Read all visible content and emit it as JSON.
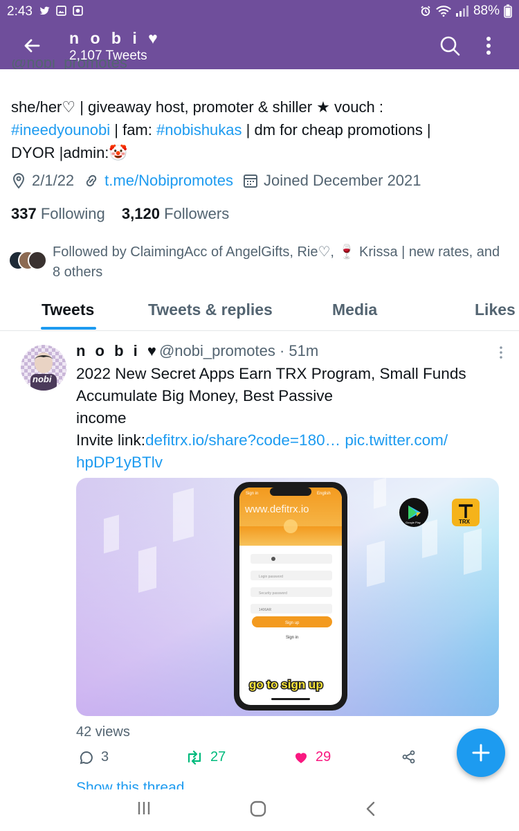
{
  "status_bar": {
    "time": "2:43",
    "battery": "88%",
    "colors": {
      "bar": "#6f4e9b"
    }
  },
  "app_bar": {
    "title": "n o b i ♥",
    "tweet_count": "2,107 Tweets"
  },
  "profile": {
    "handle": "@nobi_promotes",
    "bio": {
      "line1": "she/her♡ | giveaway host, promoter & shiller ★ vouch :",
      "hashtag1": "#ineedyounobi",
      "mid": " | fam: ",
      "hashtag2": "#nobishukas",
      "after": " | dm for cheap promotions  |",
      "line3": "DYOR |admin:",
      "emoji": "🤡"
    },
    "location": "2/1/22",
    "website": "t.me/Nobipromotes",
    "joined": "Joined December 2021",
    "following_count": "337",
    "following_label": "Following",
    "followers_count": "3,120",
    "followers_label": "Followers",
    "followed_by": "Followed by ClaimingAcc of AngelGifts, Rie♡, 🍷 Krissa | new rates, and 8 others"
  },
  "tabs": [
    {
      "label": "Tweets",
      "active": true
    },
    {
      "label": "Tweets & replies",
      "active": false
    },
    {
      "label": "Media",
      "active": false
    },
    {
      "label": "Likes",
      "active": false
    }
  ],
  "tweet": {
    "author_name": "n o b i ♥",
    "author_handle": "@nobi_promotes",
    "time": "51m",
    "avatar_text": "nobi",
    "text_line1": "2022 New Secret Apps Earn TRX Program, Small Funds",
    "text_line2": "Accumulate Big Money, Best Passive",
    "text_line3": "income",
    "invite_prefix": "Invite link:",
    "invite_link": "defitrx.io/share?code=180…",
    "pic_link": "pic.twitter.com/",
    "pic_link2": "hpDP1yBTlv",
    "media": {
      "url_text": "www.defitrx.io",
      "field_placeholder": "Login password",
      "field_placeholder2": "Security password",
      "field_code": "1406AR",
      "signup_label": "Sign up",
      "signin_label": "Sign in",
      "caption": "go to sign up",
      "store_label": "Google Play",
      "coin_label": "TRX",
      "phone_signin": "Sign in",
      "phone_english": "English"
    },
    "views": "42 views",
    "replies": "3",
    "retweets": "27",
    "likes": "29",
    "show_thread": "Show this thread",
    "colors": {
      "retweet": "#00ba7c",
      "like": "#f91880",
      "link": "#1d9bf0"
    }
  }
}
